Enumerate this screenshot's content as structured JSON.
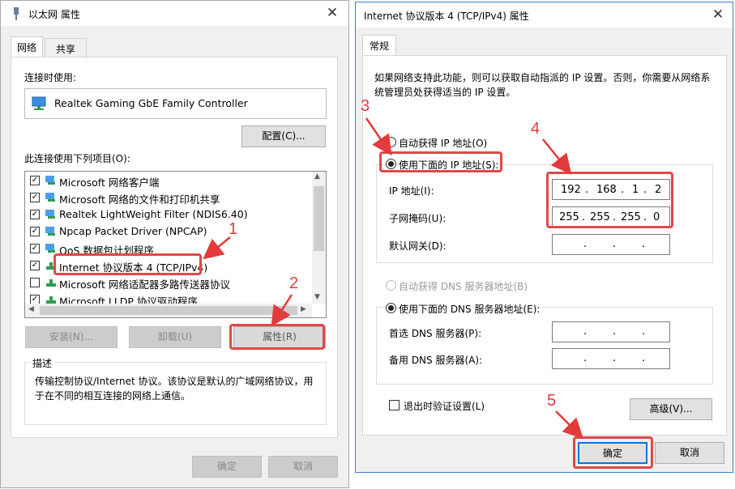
{
  "left_window": {
    "title": "以太网 属性",
    "tabs": [
      "网络",
      "共享"
    ],
    "connect_using_label": "连接时使用:",
    "adapter_name": "Realtek Gaming GbE Family Controller",
    "configure_button": "配置(C)...",
    "items_label": "此连接使用下列项目(O):",
    "items": [
      {
        "label": "Microsoft 网络客户端",
        "checked": true
      },
      {
        "label": "Microsoft 网络的文件和打印机共享",
        "checked": true
      },
      {
        "label": "Realtek LightWeight Filter (NDIS6.40)",
        "checked": true
      },
      {
        "label": "Npcap Packet Driver (NPCAP)",
        "checked": true
      },
      {
        "label": "QoS 数据包计划程序",
        "checked": true
      },
      {
        "label": "Internet 协议版本 4 (TCP/IPv4)",
        "checked": true
      },
      {
        "label": "Microsoft 网络适配器多路传送器协议",
        "checked": false
      },
      {
        "label": "Microsoft LLDP 协议驱动程序",
        "checked": true
      }
    ],
    "install_button": "安装(N)...",
    "uninstall_button": "卸载(U)",
    "properties_button": "属性(R)",
    "description_title": "描述",
    "description_text": "传输控制协议/Internet 协议。该协议是默认的广域网络协议，用于在不同的相互连接的网络上通信。",
    "ok_button": "确定",
    "cancel_button": "取消"
  },
  "right_window": {
    "title": "Internet 协议版本 4 (TCP/IPv4) 属性",
    "tab": "常规",
    "intro_text": "如果网络支持此功能，则可以获取自动指派的 IP 设置。否则，你需要从网络系统管理员处获得适当的 IP 设置。",
    "auto_ip_radio": "自动获得 IP 地址(O)",
    "manual_ip_radio": "使用下面的 IP 地址(S):",
    "ip_address_label": "IP 地址(I):",
    "ip_address": [
      "192",
      "168",
      "1",
      "2"
    ],
    "subnet_label": "子网掩码(U):",
    "subnet_mask": [
      "255",
      "255",
      "255",
      "0"
    ],
    "gateway_label": "默认网关(D):",
    "auto_dns_radio": "自动获得 DNS 服务器地址(B)",
    "manual_dns_radio": "使用下面的 DNS 服务器地址(E):",
    "preferred_dns_label": "首选 DNS 服务器(P):",
    "alternate_dns_label": "备用 DNS 服务器(A):",
    "validate_checkbox": "退出时验证设置(L)",
    "advanced_button": "高级(V)...",
    "ok_button": "确定",
    "cancel_button": "取消"
  },
  "annotations": [
    "1",
    "2",
    "3",
    "4",
    "5"
  ],
  "colors": {
    "highlight": "#e04848",
    "window_bg": "#f0f0f0"
  }
}
